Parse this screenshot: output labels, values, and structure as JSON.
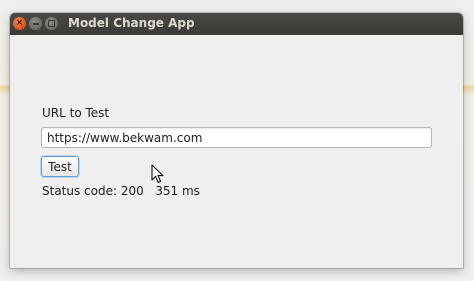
{
  "window": {
    "title": "Model Change App"
  },
  "form": {
    "url_label": "URL to Test",
    "url_value": "https://www.bekwam.com",
    "test_button_label": "Test",
    "status_label": "Status code:",
    "status_code": "200",
    "response_time": "351 ms"
  },
  "icons": {
    "close": "close-icon",
    "minimize": "minimize-icon",
    "maximize": "maximize-icon",
    "cursor": "mouse-pointer-icon"
  },
  "colors": {
    "titlebar": "#3c3b37",
    "close_button": "#e0561f",
    "button_focus": "#5b9bd5",
    "window_bg": "#f0efef"
  }
}
